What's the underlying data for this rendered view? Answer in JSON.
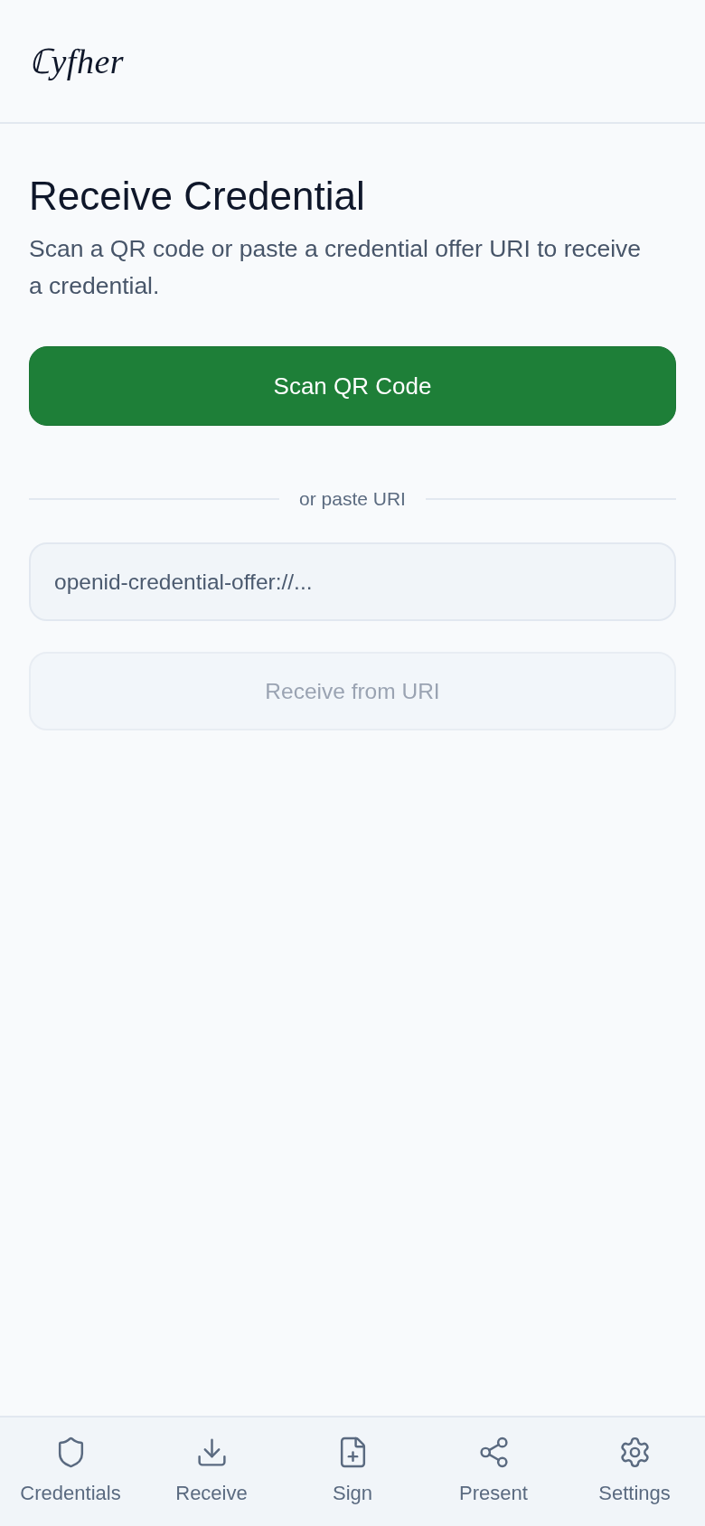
{
  "header": {
    "logo": "ℂyfher"
  },
  "page": {
    "title": "Receive Credential",
    "subtitle": "Scan a QR code or paste a credential offer URI to receive a credential."
  },
  "scan_button": {
    "label": "Scan QR Code"
  },
  "divider": {
    "label": "or paste URI"
  },
  "uri_field": {
    "placeholder": "openid-credential-offer://..."
  },
  "receive_button": {
    "label": "Receive from URI",
    "disabled": true
  },
  "nav": {
    "items": [
      {
        "label": "Credentials"
      },
      {
        "label": "Receive"
      },
      {
        "label": "Sign"
      },
      {
        "label": "Present"
      },
      {
        "label": "Settings"
      }
    ]
  }
}
